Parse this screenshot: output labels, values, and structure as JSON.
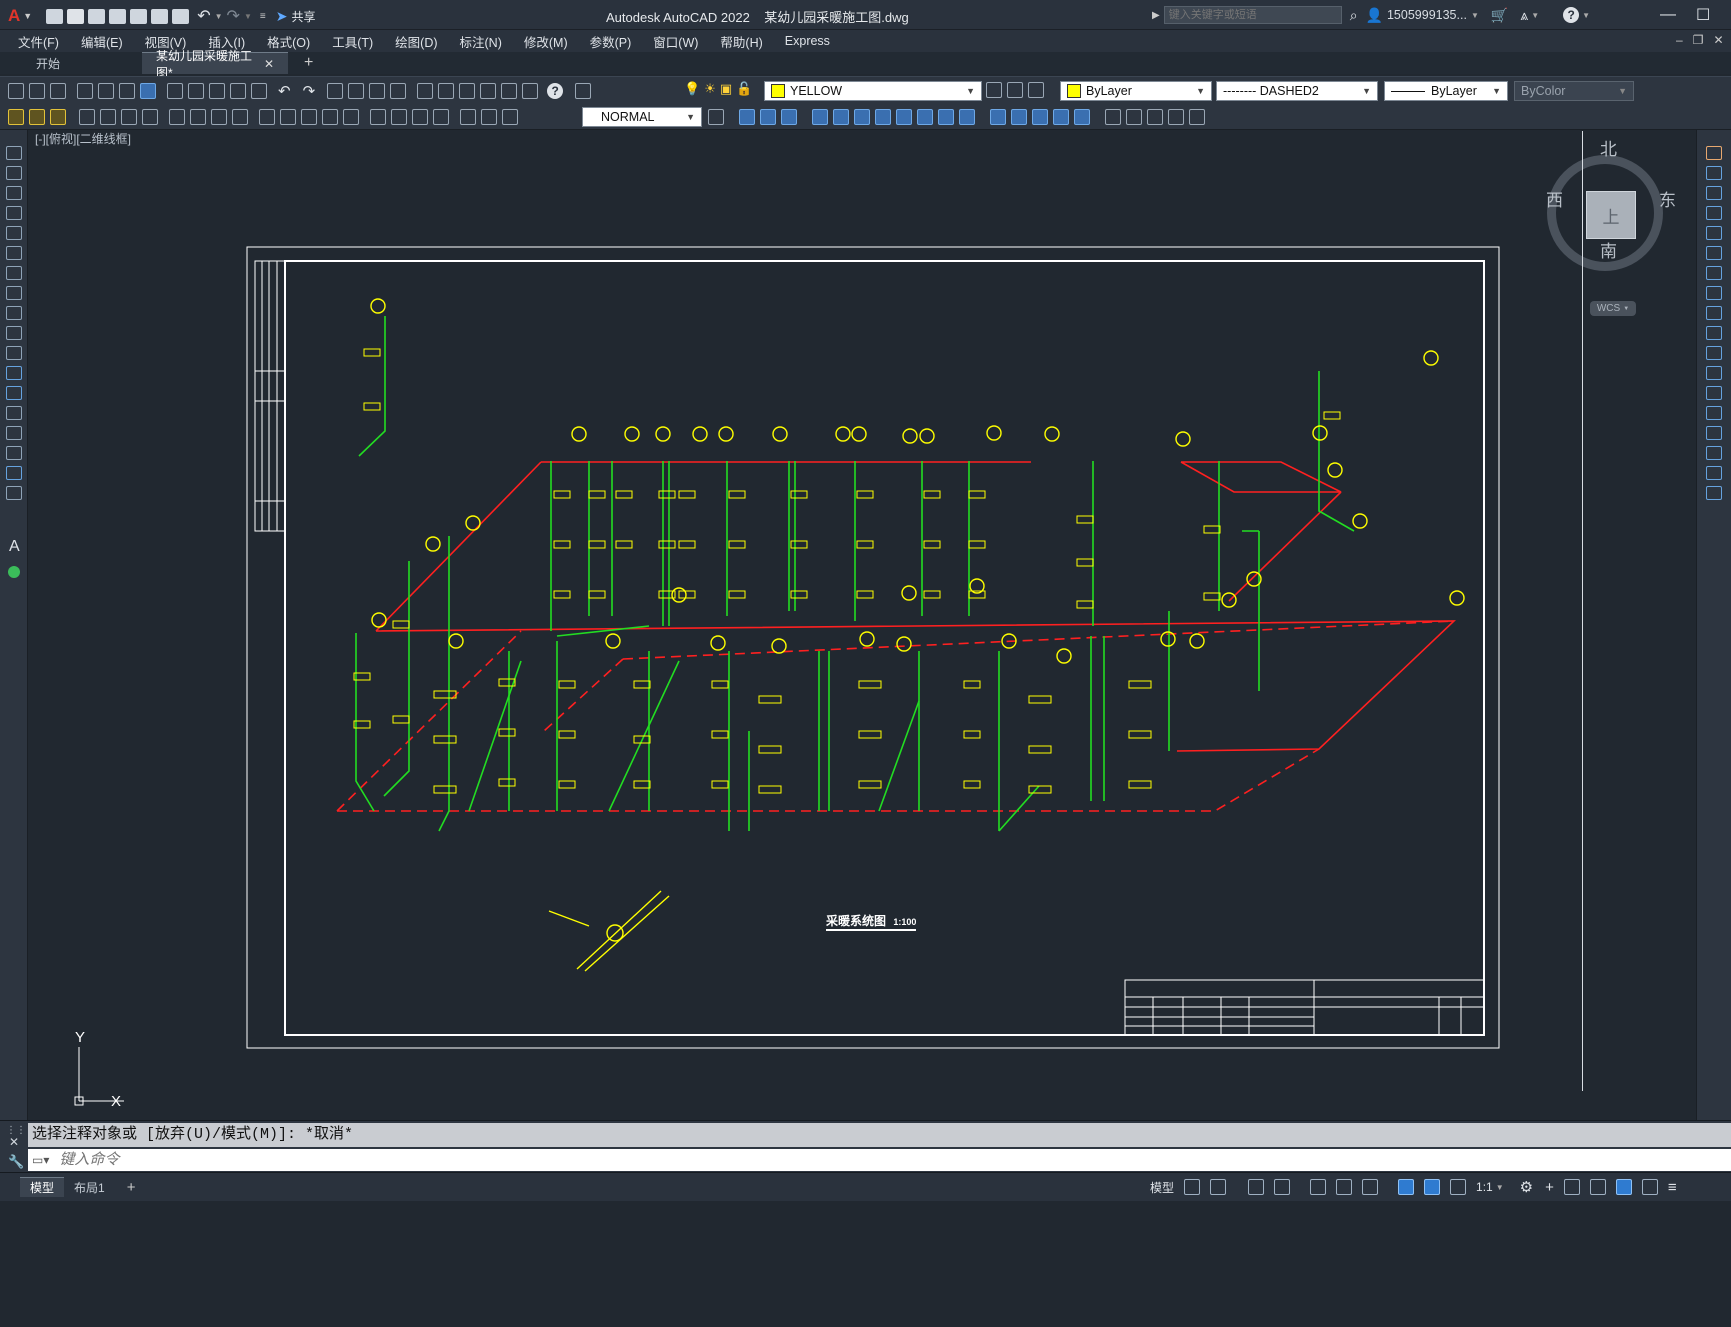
{
  "app": {
    "logo": "A",
    "share_label": "共享",
    "title": "Autodesk AutoCAD 2022    某幼儿园采暖施工图.dwg",
    "search_placeholder": "键入关键字或短语",
    "user": "1505999135...",
    "help": "?"
  },
  "menu": [
    "文件(F)",
    "编辑(E)",
    "视图(V)",
    "插入(I)",
    "格式(O)",
    "工具(T)",
    "绘图(D)",
    "标注(N)",
    "修改(M)",
    "参数(P)",
    "窗口(W)",
    "帮助(H)",
    "Express"
  ],
  "tabs": [
    {
      "label": "开始"
    },
    {
      "label": "某幼儿园采暖施工图*"
    }
  ],
  "toolbar": {
    "layer_name": "YELLOW",
    "layer_color": "#ffff00",
    "color_value": "ByLayer",
    "linetype_value": "-------- DASHED2",
    "lineweight_value": "ByLayer",
    "plotstyle_value": "ByColor",
    "dimstyle_value": "NORMAL"
  },
  "viewport": {
    "label": "[-][俯视][二维线框]",
    "viewcube": {
      "north": "北",
      "south": "南",
      "east": "东",
      "west": "西",
      "face": "上",
      "wcs": "WCS"
    },
    "ucs_x": "X",
    "ucs_y": "Y"
  },
  "drawing": {
    "title": "采暖系统图",
    "scale": "1:100",
    "pipe_supply_color": "#ff2020",
    "pipe_riser_color": "#22dd22",
    "annotation_color": "#ffff00",
    "frame_color": "#ffffff"
  },
  "command": {
    "history": "选择注释对象或 [放弃(U)/模式(M)]: *取消*",
    "placeholder": "键入命令"
  },
  "status": {
    "layout_tabs": [
      "模型",
      "布局1"
    ],
    "model_label": "模型",
    "scale": "1:1"
  }
}
